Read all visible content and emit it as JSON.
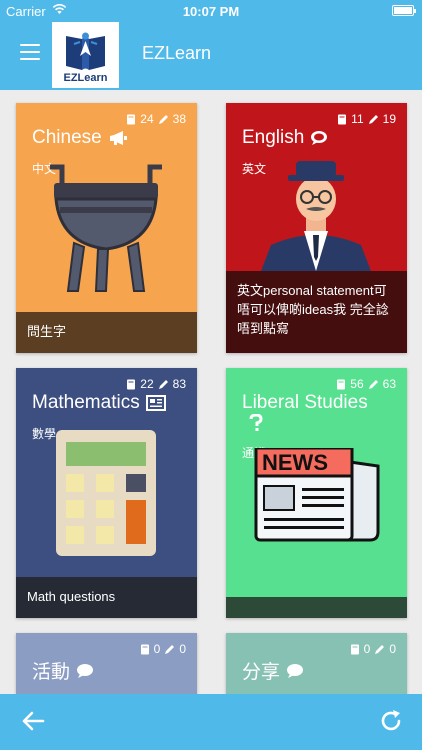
{
  "status_bar": {
    "carrier": "Carrier",
    "time": "10:07 PM"
  },
  "header": {
    "title": "EZLearn",
    "logo_text": "EZLearn"
  },
  "colors": {
    "accent": "#4fb9e9"
  },
  "cards": [
    {
      "title": "Chinese",
      "subtitle": "中文",
      "count_book": "24",
      "count_pencil": "38",
      "footer": "問生字",
      "color": "#f7a44e",
      "title_icon": "megaphone-icon",
      "image": "cauldron-image"
    },
    {
      "title": "English",
      "subtitle": "英文",
      "count_book": "11",
      "count_pencil": "19",
      "footer": "英文personal statement可唔可以俾啲ideas我 完全諗唔到點寫",
      "color": "#c0161b",
      "title_icon": "comments-icon",
      "image": "gentleman-image"
    },
    {
      "title": "Mathematics",
      "subtitle": "數學",
      "count_book": "22",
      "count_pencil": "83",
      "footer": "Math questions",
      "color": "#3c4f80",
      "title_icon": "newspaper-icon",
      "image": "calculator-image"
    },
    {
      "title": "Liberal Studies",
      "subtitle": "通識",
      "count_book": "56",
      "count_pencil": "63",
      "footer": "",
      "color": "#57e08f",
      "title_icon": "question-icon",
      "image": "newspaper-image"
    },
    {
      "title": "活動",
      "subtitle": "",
      "count_book": "0",
      "count_pencil": "0",
      "footer": "",
      "color": "#8b9dc3",
      "title_icon": "comments-icon"
    },
    {
      "title": "分享",
      "subtitle": "",
      "count_book": "0",
      "count_pencil": "0",
      "footer": "",
      "color": "#87c1b3",
      "title_icon": "comments-icon"
    }
  ]
}
